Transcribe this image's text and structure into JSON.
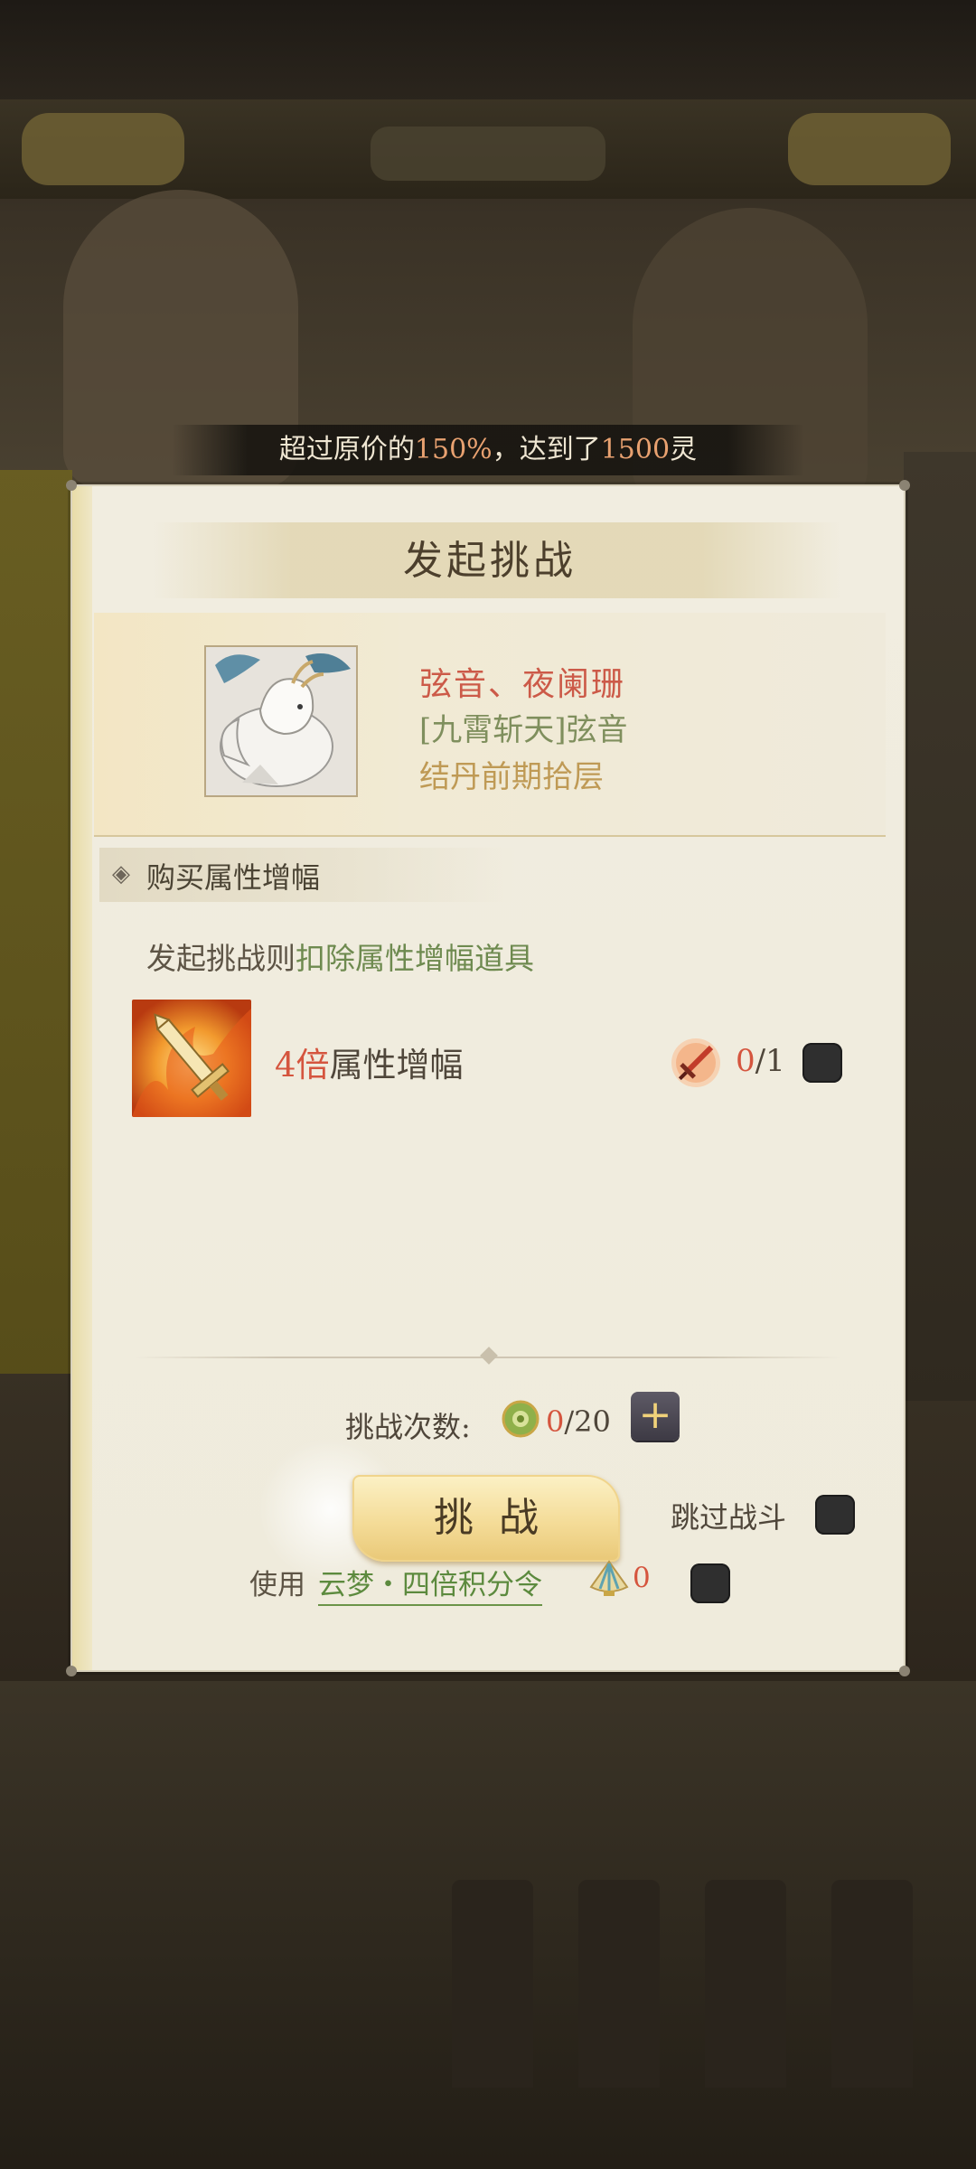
{
  "notice": {
    "prefix": "超过原价的",
    "percent": "150%",
    "middle": "，达到了",
    "amount": "1500",
    "suffix": "灵"
  },
  "panel": {
    "title": "发起挑战",
    "character": {
      "name": "弦音、夜阑珊",
      "title": "[九霄斩天]弦音",
      "realm": "结丹前期拾层"
    },
    "section_title": "购买属性增幅",
    "description": {
      "prefix": "发起挑战则",
      "highlight": "扣除属性增幅道具"
    },
    "boost": {
      "multiplier": "4倍",
      "label": "属性增幅",
      "owned": "0",
      "required": "/1",
      "selected": false
    },
    "tries": {
      "label": "挑战次数:",
      "used": "0",
      "total": "/20",
      "add_label": "+"
    },
    "challenge_button": "挑战",
    "skip_battle": {
      "label": "跳过战斗",
      "checked": false
    },
    "use_item": {
      "prefix": "使用",
      "item_name": "云梦・四倍积分令",
      "count": "0",
      "checked": false
    }
  },
  "colors": {
    "accent_red": "#d5553e",
    "accent_green": "#6e8a4f",
    "panel_bg": "#efebdc",
    "button_gold": "#f4dc98"
  },
  "icons": {
    "portrait": "kirin-portrait",
    "boost": "flaming-sword-icon",
    "token": "sword-token-icon",
    "tries": "jade-token-icon",
    "use_item": "shell-token-icon"
  }
}
